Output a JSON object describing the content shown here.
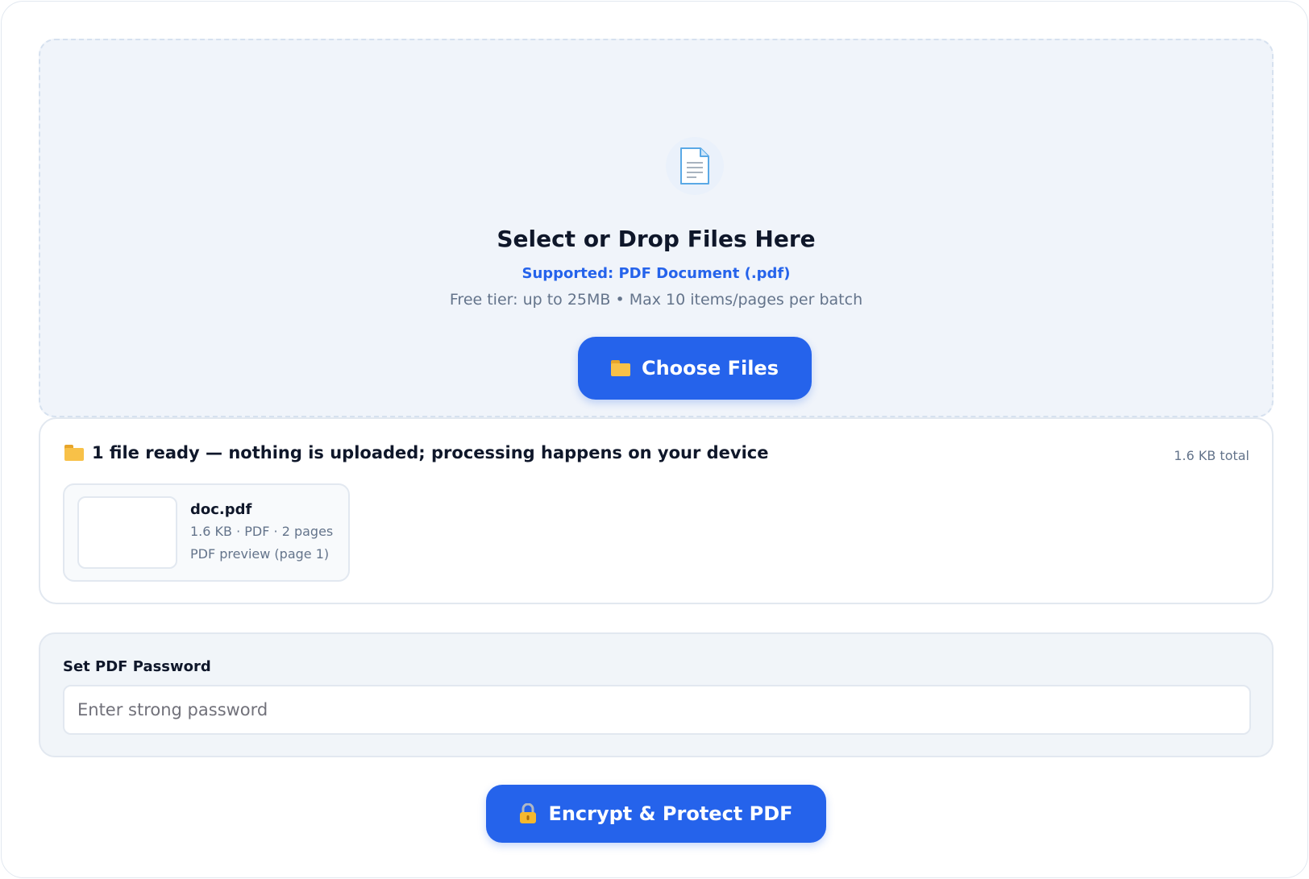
{
  "dropzone": {
    "icon": "document-icon",
    "title": "Select or Drop Files Here",
    "supported": "Supported: PDF Document (.pdf)",
    "limits": "Free tier: up to 25MB • Max 10 items/pages per batch",
    "choose_button": {
      "icon": "folder-icon",
      "label": "Choose Files"
    }
  },
  "files": {
    "header_icon": "folder-icon",
    "header": "1 file ready — nothing is uploaded; processing happens on your device",
    "total": "1.6 KB total",
    "items": [
      {
        "name": "doc.pdf",
        "meta": "1.6 KB · PDF · 2 pages",
        "preview": "PDF preview (page 1)"
      }
    ]
  },
  "password": {
    "label": "Set PDF Password",
    "placeholder": "Enter strong password",
    "value": ""
  },
  "encrypt_button": {
    "icon": "lock-icon",
    "label": "Encrypt & Protect PDF"
  },
  "colors": {
    "accent": "#2563eb",
    "text": "#0f172a",
    "muted": "#64748b",
    "dropzone_bg": "#f0f4fa",
    "panel_bg": "#f1f5f9",
    "border": "#e2e8f0"
  }
}
